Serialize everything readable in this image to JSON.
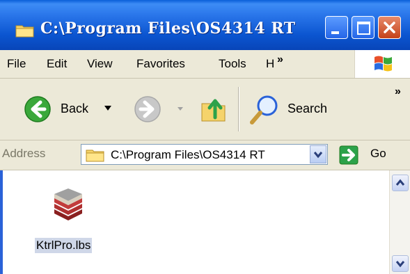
{
  "window": {
    "title": "C:\\Program Files\\OS4314 RT"
  },
  "menu": {
    "items": [
      "File",
      "Edit",
      "View",
      "Favorites",
      "Tools",
      "H"
    ],
    "overflow": "»"
  },
  "toolbar": {
    "back_label": "Back",
    "search_label": "Search",
    "overflow": "»"
  },
  "address": {
    "label": "Address",
    "value": "C:\\Program Files\\OS4314 RT",
    "go_label": "Go"
  },
  "files": [
    {
      "name": "KtrlPro.lbs",
      "icon": "books-icon"
    }
  ],
  "colors": {
    "titlebar": "#0b55d0",
    "chrome": "#ece9d8",
    "selection": "#cfd7e8",
    "go_green": "#2ca24a"
  }
}
